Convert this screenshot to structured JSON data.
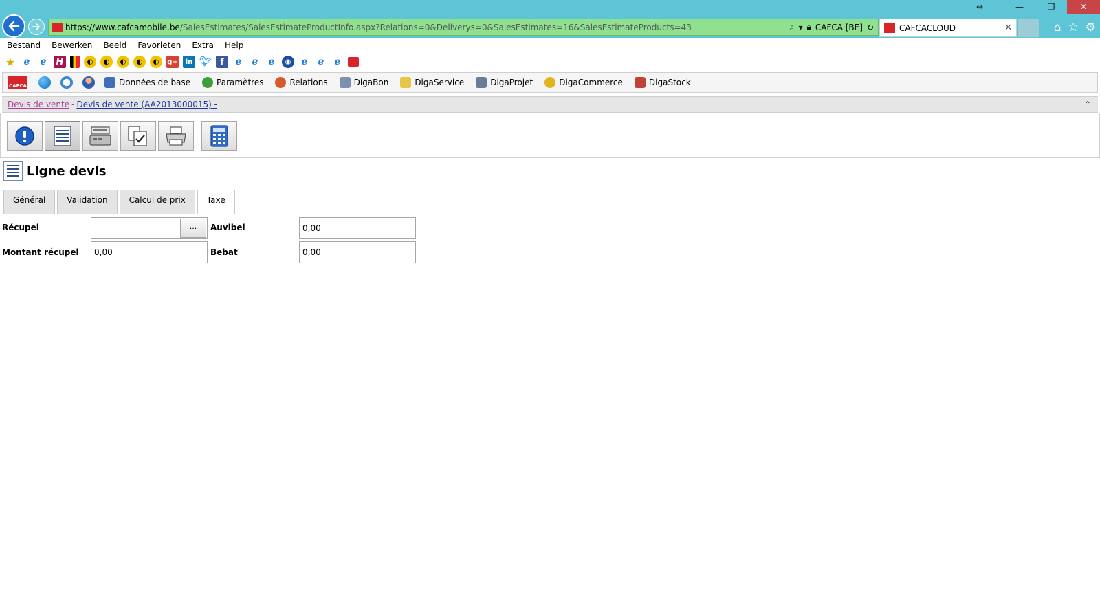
{
  "browser": {
    "address": {
      "scheme": "https://",
      "host": "www.cafcamobile.be",
      "path": "/SalesEstimates/SalesEstimateProductInfo.aspx?Relations=0&Deliverys=0&SalesEstimates=16&SalesEstimateProducts=43",
      "cert": "CAFCA [BE]"
    },
    "tab_title": "CAFCACLOUD",
    "menu": [
      "Bestand",
      "Bewerken",
      "Beeld",
      "Favorieten",
      "Extra",
      "Help"
    ]
  },
  "app": {
    "menu": {
      "items": [
        {
          "label": "Données de base",
          "color": "#3f6fb8"
        },
        {
          "label": "Paramètres",
          "color": "#3f9e3a"
        },
        {
          "label": "Relations",
          "color": "#d65a2a"
        },
        {
          "label": "DigaBon",
          "color": "#7d8fae"
        },
        {
          "label": "DigaService",
          "color": "#e6c64a"
        },
        {
          "label": "DigaProjet",
          "color": "#6b7c96"
        },
        {
          "label": "DigaCommerce",
          "color": "#e3b31b"
        },
        {
          "label": "DigaStock",
          "color": "#c0433a"
        }
      ]
    },
    "breadcrumb": {
      "level1": "Devis de vente",
      "separator": "-",
      "level2": "Devis de vente (AA2013000015) -"
    },
    "page_title": "Ligne devis",
    "tabs": [
      {
        "label": "Général",
        "active": false
      },
      {
        "label": "Validation",
        "active": false
      },
      {
        "label": "Calcul de prix",
        "active": false
      },
      {
        "label": "Taxe",
        "active": true
      }
    ],
    "form": {
      "recupel_label": "Récupel",
      "recupel_value": "",
      "lookup_label": "···",
      "montant_recupel_label": "Montant récupel",
      "montant_recupel_value": "0,00",
      "auvibel_label": "Auvibel",
      "auvibel_value": "0,00",
      "bebat_label": "Bebat",
      "bebat_value": "0,00"
    }
  },
  "colors": {
    "titlebar": "#5ec5d6",
    "address_secure": "#8fe08f",
    "brand_red": "#d9252a",
    "breadcrumb_link": "#b0419c",
    "breadcrumb_current": "#1e3aa0"
  }
}
